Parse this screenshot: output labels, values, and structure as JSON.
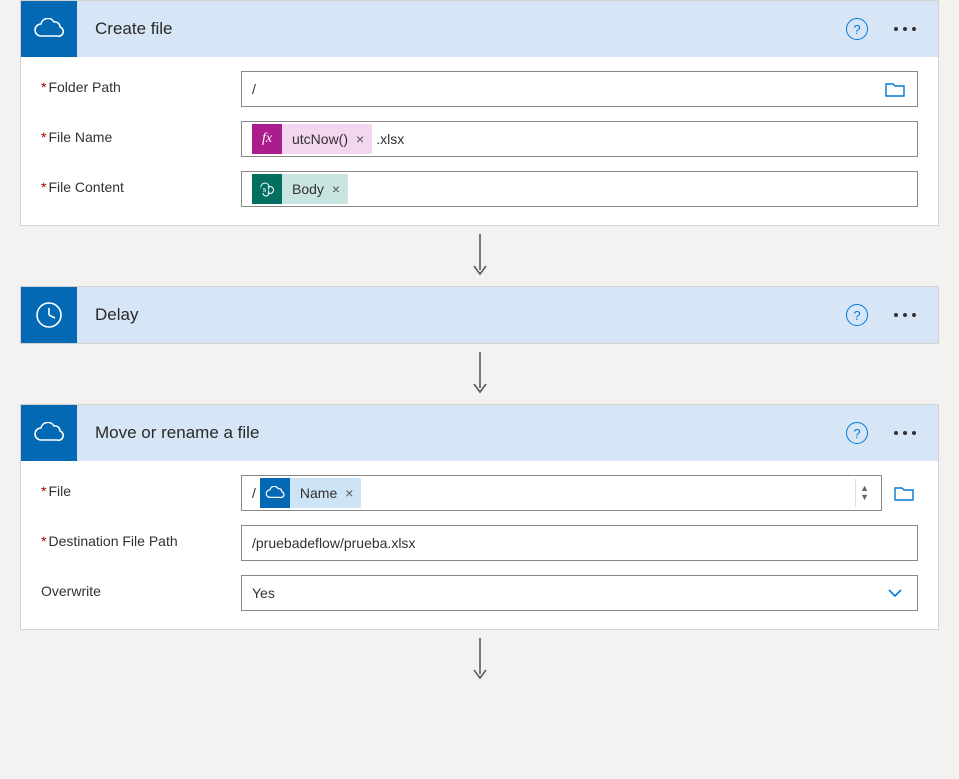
{
  "actions": {
    "createFile": {
      "title": "Create file",
      "fields": {
        "folderPath": {
          "label": "Folder Path",
          "value": "/"
        },
        "fileName": {
          "label": "File Name",
          "token": "utcNow()",
          "suffix": ".xlsx"
        },
        "fileContent": {
          "label": "File Content",
          "token": "Body"
        }
      }
    },
    "delay": {
      "title": "Delay"
    },
    "moveRename": {
      "title": "Move or rename a file",
      "fields": {
        "file": {
          "label": "File",
          "prefix": "/",
          "token": "Name"
        },
        "destPath": {
          "label": "Destination File Path",
          "value": "/pruebadeflow/prueba.xlsx"
        },
        "overwrite": {
          "label": "Overwrite",
          "value": "Yes"
        }
      }
    }
  },
  "icons": {
    "fx": "fx",
    "sharepoint": "s"
  }
}
